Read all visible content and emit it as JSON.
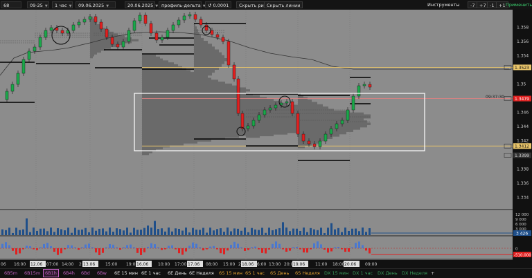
{
  "toolbar": {
    "symbol": "68",
    "contract": "09-25",
    "timeframe": "1 час",
    "date_from": "09.06.2025",
    "date_to": "20.06.2025",
    "profile_type": "профиль-дельта",
    "tick_size": "0.0001",
    "hide_levels": "Скрыть рис.",
    "hide_lines": "Скрыть линии",
    "instruments": "Инструменты",
    "btn_minus7": "-7",
    "btn_plus7": "+7",
    "btn_minus1": "-1",
    "btn_plus1": "+1",
    "apply": "Применить"
  },
  "price_axis": {
    "labels": [
      "1.358",
      "1.356",
      "1.354",
      "1.35",
      "1.348",
      "1.346",
      "1.344",
      "1.342",
      "1.338",
      "1.336",
      "1.334"
    ],
    "badges": [
      {
        "text": "1.3523",
        "color": "#e8c46a"
      },
      {
        "text": "1.3479",
        "color": "#e8c46a"
      },
      {
        "text": "1.3412",
        "color": "#e8c46a"
      },
      {
        "text": "1.3399",
        "color": "#333333"
      }
    ],
    "current_price": "1.3479",
    "current_time": "09:37:30"
  },
  "volume_axis": {
    "labels": [
      "12 000",
      "9 000",
      "6 000",
      "3 000"
    ],
    "current": "3 426"
  },
  "delta_axis": {
    "labels": [
      "0"
    ],
    "current": "-510.000"
  },
  "time_axis": {
    "labels": [
      "06",
      "16:00",
      "12.06",
      "07:00",
      "14:00",
      "2",
      "13.06",
      "15:00",
      "19:00",
      "16.06",
      "10:00",
      "17:00",
      "17.06",
      "08:00",
      "15:00",
      "2",
      "18.06",
      "06:00",
      "13:00",
      "20:00",
      "19.06",
      "11:00",
      "18:00",
      "20.06",
      "09:00"
    ]
  },
  "tabs": [
    {
      "label": "6B5m",
      "color": "#c060c0"
    },
    {
      "label": "6B15m",
      "color": "#c060c0"
    },
    {
      "label": "6B1h",
      "color": "#c060c0",
      "active": true
    },
    {
      "label": "6B4h",
      "color": "#c060c0"
    },
    {
      "label": "6Bd",
      "color": "#c060c0"
    },
    {
      "label": "6Bw",
      "color": "#c060c0"
    },
    {
      "label": "6E 15 мин",
      "color": "#e6e6e6"
    },
    {
      "label": "6E 1 час",
      "color": "#e6e6e6"
    },
    {
      "label": "6E День",
      "color": "#e6e6e6"
    },
    {
      "label": "6E Неделя",
      "color": "#e6e6e6"
    },
    {
      "label": "6S 15 мин",
      "color": "#e0a030"
    },
    {
      "label": "6S 1 час",
      "color": "#e0a030"
    },
    {
      "label": "6S День",
      "color": "#e0a030"
    },
    {
      "label": "6S Неделя",
      "color": "#e0a030"
    },
    {
      "label": "DX 15 мин",
      "color": "#3a9a5a"
    },
    {
      "label": "DX 1 час",
      "color": "#3a9a5a"
    },
    {
      "label": "DX День",
      "color": "#3a9a5a"
    },
    {
      "label": "DX Неделя",
      "color": "#3a9a5a"
    },
    {
      "label": "+",
      "color": "#dddddd"
    }
  ],
  "colors": {
    "up": "#1aa84a",
    "down": "#e02020",
    "volume": "#1f4f8a",
    "delta_pos": "#4a78d0",
    "delta_neg": "#e02020",
    "level": "#e8c46a",
    "plot_bg": "#8c8c8c"
  }
}
